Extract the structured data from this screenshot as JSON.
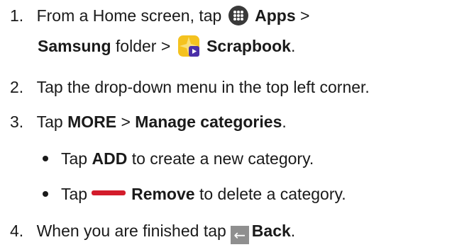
{
  "steps": [
    {
      "number": "1.",
      "line1": {
        "pre": "From a Home screen, tap",
        "apps": "Apps",
        "sep": ">"
      },
      "line2": {
        "samsung": "Samsung",
        "folder": "folder >",
        "scrapbook": "Scrapbook",
        "end": "."
      },
      "icons": [
        "apps-grid-icon",
        "scrapbook-app-icon"
      ]
    },
    {
      "number": "2.",
      "text": "Tap the drop-down menu in the top left corner."
    },
    {
      "number": "3.",
      "pre": "Tap",
      "more": "MORE",
      "sep": ">",
      "manage": "Manage categories",
      "end": "."
    },
    {
      "number": "4.",
      "pre": "When you are finished tap",
      "back": "Back",
      "end": ".",
      "icon": "back-arrow-icon"
    }
  ],
  "bullets": [
    {
      "pre": "Tap",
      "bold": "ADD",
      "post": "to create a new category."
    },
    {
      "pre": "Tap",
      "bold": "Remove",
      "post": "to delete a category.",
      "icon": "remove-bar-icon"
    }
  ],
  "colors": {
    "remove_bar": "#d31c2b",
    "back_icon_bg": "#8f8f8f",
    "apps_icon_bg": "#3a3a3a"
  }
}
